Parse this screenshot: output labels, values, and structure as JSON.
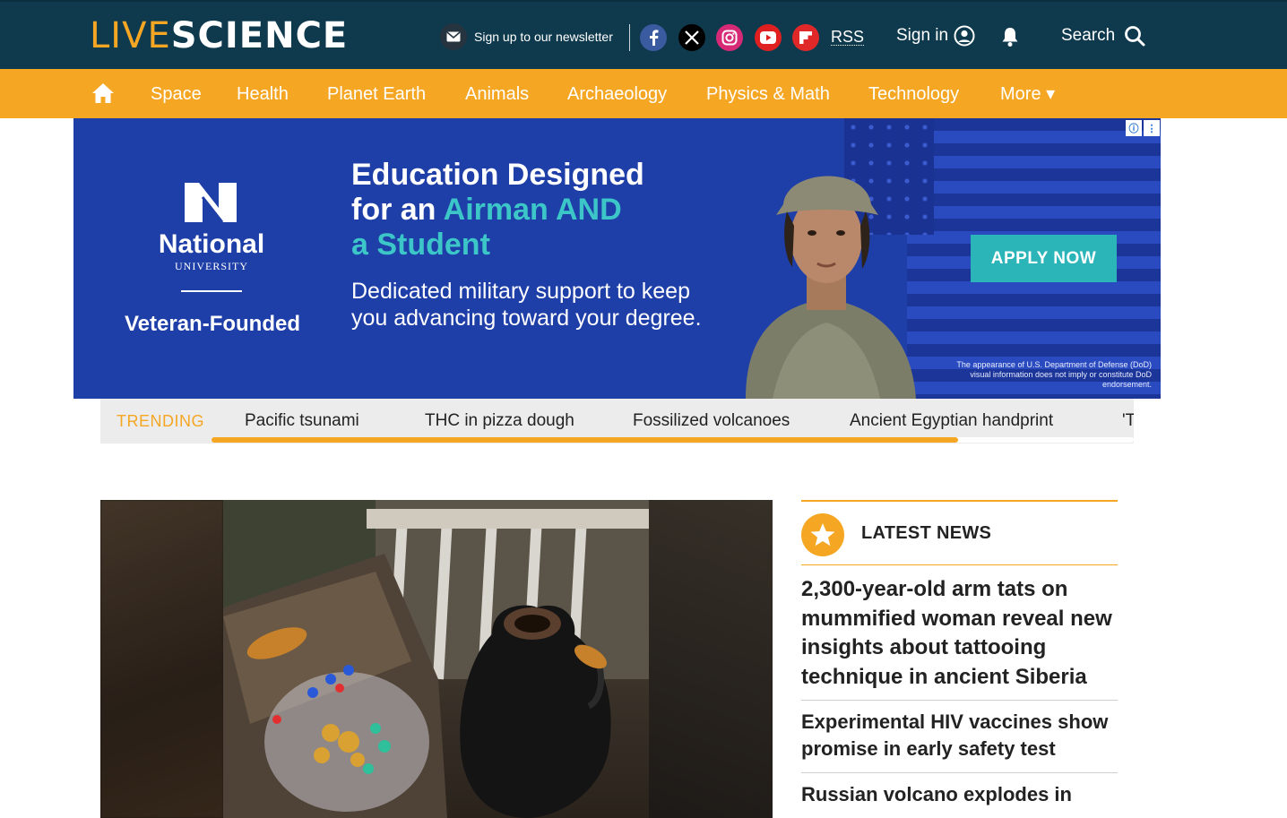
{
  "header": {
    "logo_live": "LIVE",
    "logo_science": "SCIENCE",
    "newsletter_label": "Sign up to our newsletter",
    "rss_label": "RSS",
    "signin_label": "Sign in",
    "search_label": "Search",
    "social": [
      {
        "name": "facebook",
        "glyph": "f",
        "color": "#3a5ba0"
      },
      {
        "name": "x",
        "glyph": "X",
        "color": "#000000"
      },
      {
        "name": "instagram",
        "glyph": "◎",
        "color": "#d62976"
      },
      {
        "name": "youtube",
        "glyph": "▶",
        "color": "#e02020"
      },
      {
        "name": "flipboard",
        "glyph": "F",
        "color": "#e12828"
      }
    ]
  },
  "nav": {
    "items": [
      "Space",
      "Health",
      "Planet Earth",
      "Animals",
      "Archaeology",
      "Physics & Math",
      "Technology",
      "More ▾"
    ]
  },
  "ad": {
    "brand_name": "National",
    "brand_sub": "UNIVERSITY",
    "brand_tagline": "Veteran-Founded",
    "headline_1": "Education Designed",
    "headline_2": "for an ",
    "headline_accent": "Airman AND",
    "headline_3": "a Student",
    "subtext": "Dedicated military support to keep you advancing toward your degree.",
    "cta": "APPLY NOW",
    "disclaimer": "The appearance of U.S. Department of Defense (DoD) visual information does not imply or constitute DoD endorsement.",
    "info_icon": "ⓘ",
    "menu_icon": "⋮"
  },
  "trending": {
    "label": "TRENDING",
    "items": [
      "Pacific tsunami",
      "THC in pizza dough",
      "Fossilized volcanoes",
      "Ancient Egyptian handprint",
      "'T"
    ],
    "scroll_progress": 0.81
  },
  "latest_news": {
    "title": "LATEST NEWS",
    "items": [
      "2,300-year-old arm tats on mummified woman reveal new insights about tattooing technique in ancient Siberia",
      "Experimental HIV vaccines show promise in early safety test",
      "Russian volcano explodes in"
    ]
  },
  "colors": {
    "brand_orange": "#f5a623",
    "header_bg": "#0f3a4e",
    "ad_blue": "#1e3ea8",
    "ad_teal": "#2cb5b8"
  }
}
